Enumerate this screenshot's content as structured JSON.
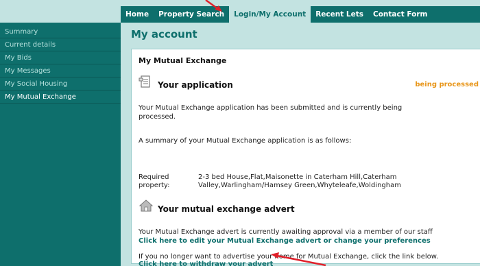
{
  "nav": {
    "tabs": [
      {
        "label": "Home"
      },
      {
        "label": "Property Search"
      },
      {
        "label": "Login/My Account"
      },
      {
        "label": "Recent Lets"
      },
      {
        "label": "Contact Form"
      }
    ],
    "active": "Login/My Account"
  },
  "sidebar": {
    "items": [
      {
        "label": "Summary"
      },
      {
        "label": "Current details"
      },
      {
        "label": "My Bids"
      },
      {
        "label": "My Messages"
      },
      {
        "label": "My Social Housing"
      },
      {
        "label": "My Mutual Exchange"
      }
    ]
  },
  "page": {
    "title": "My account"
  },
  "panel": {
    "heading": "My Mutual Exchange",
    "application": {
      "title": "Your application",
      "status": "being processed",
      "text1": "Your Mutual Exchange application has been submitted and is currently being processed.",
      "text2": "A summary of your Mutual Exchange application is as follows:",
      "required_label": "Required property:",
      "required_value": "2-3 bed House,Flat,Maisonette in Caterham Hill,Caterham Valley,Warlingham/Hamsey Green,Whyteleafe,Woldingham"
    },
    "advert": {
      "title": "Your mutual exchange advert",
      "text1": "Your Mutual Exchange advert is currently awaiting approval via a member of our staff",
      "edit_link": "Click here to edit your Mutual Exchange advert or change your preferences",
      "text2": "If you no longer want to advertise your home for Mutual Exchange, click the link below.",
      "withdraw_link": "Click here to withdraw your advert"
    }
  },
  "colors": {
    "nav_bg": "#0e6f6c",
    "page_bg": "#c3e3e1",
    "status": "#e8961a",
    "arrow": "#e0202a"
  }
}
